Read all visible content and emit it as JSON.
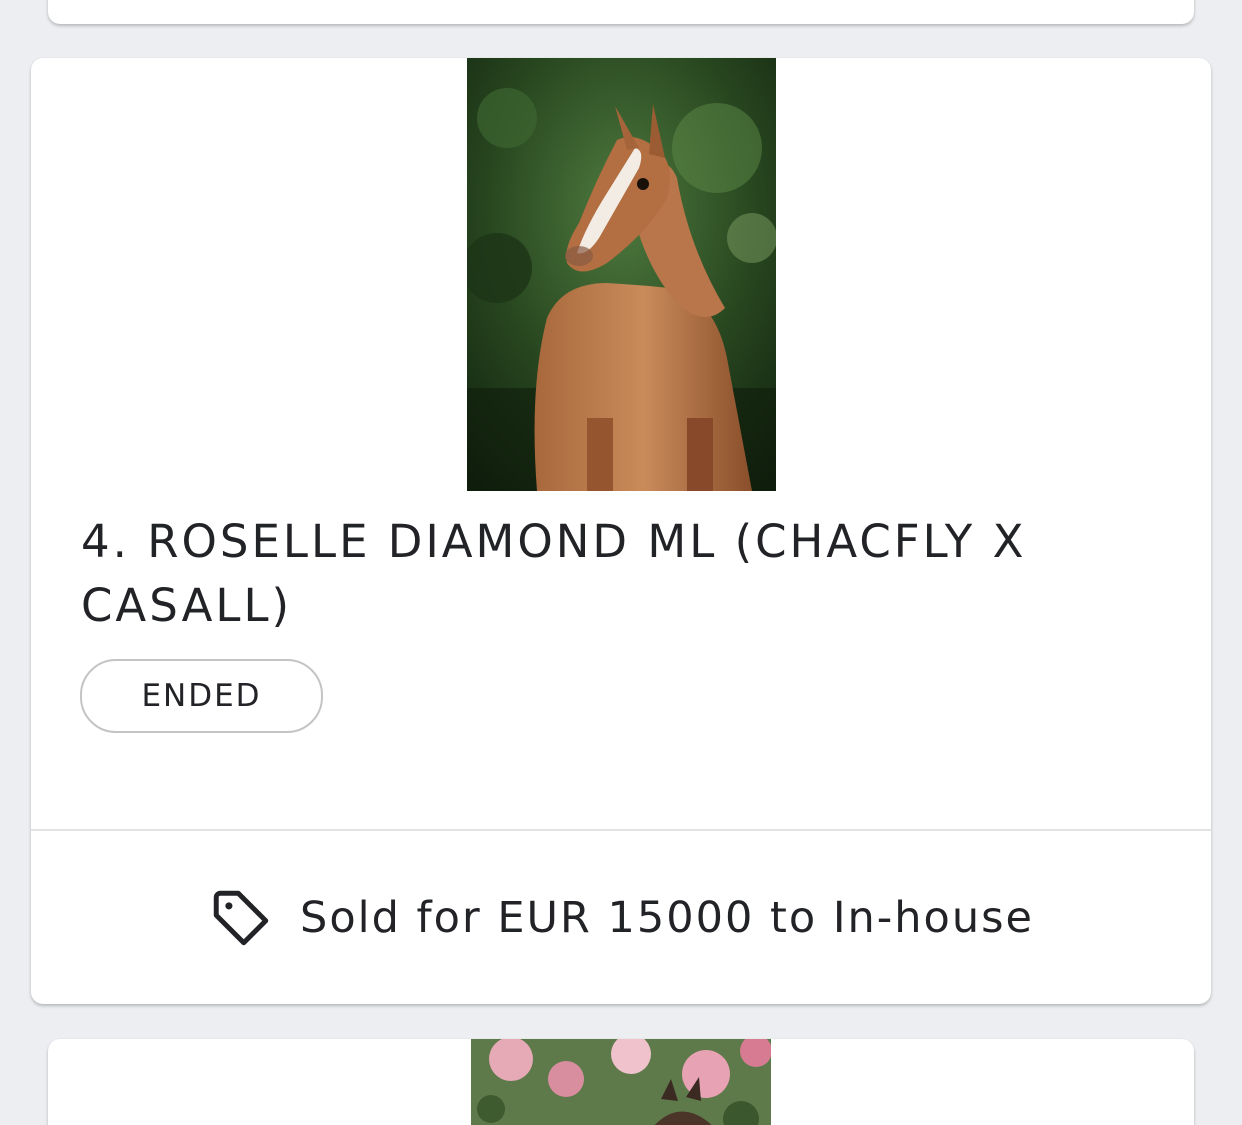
{
  "lot": {
    "title": "4. ROSELLE DIAMOND ML (CHACFLY X CASALL)",
    "status": "ENDED",
    "sold_text": "Sold for EUR 15000 to In-house",
    "sold_icon": "tag-icon"
  },
  "colors": {
    "background": "#eceef1",
    "card": "#ffffff",
    "text": "#222326",
    "badge_border": "#c4c4c4"
  }
}
